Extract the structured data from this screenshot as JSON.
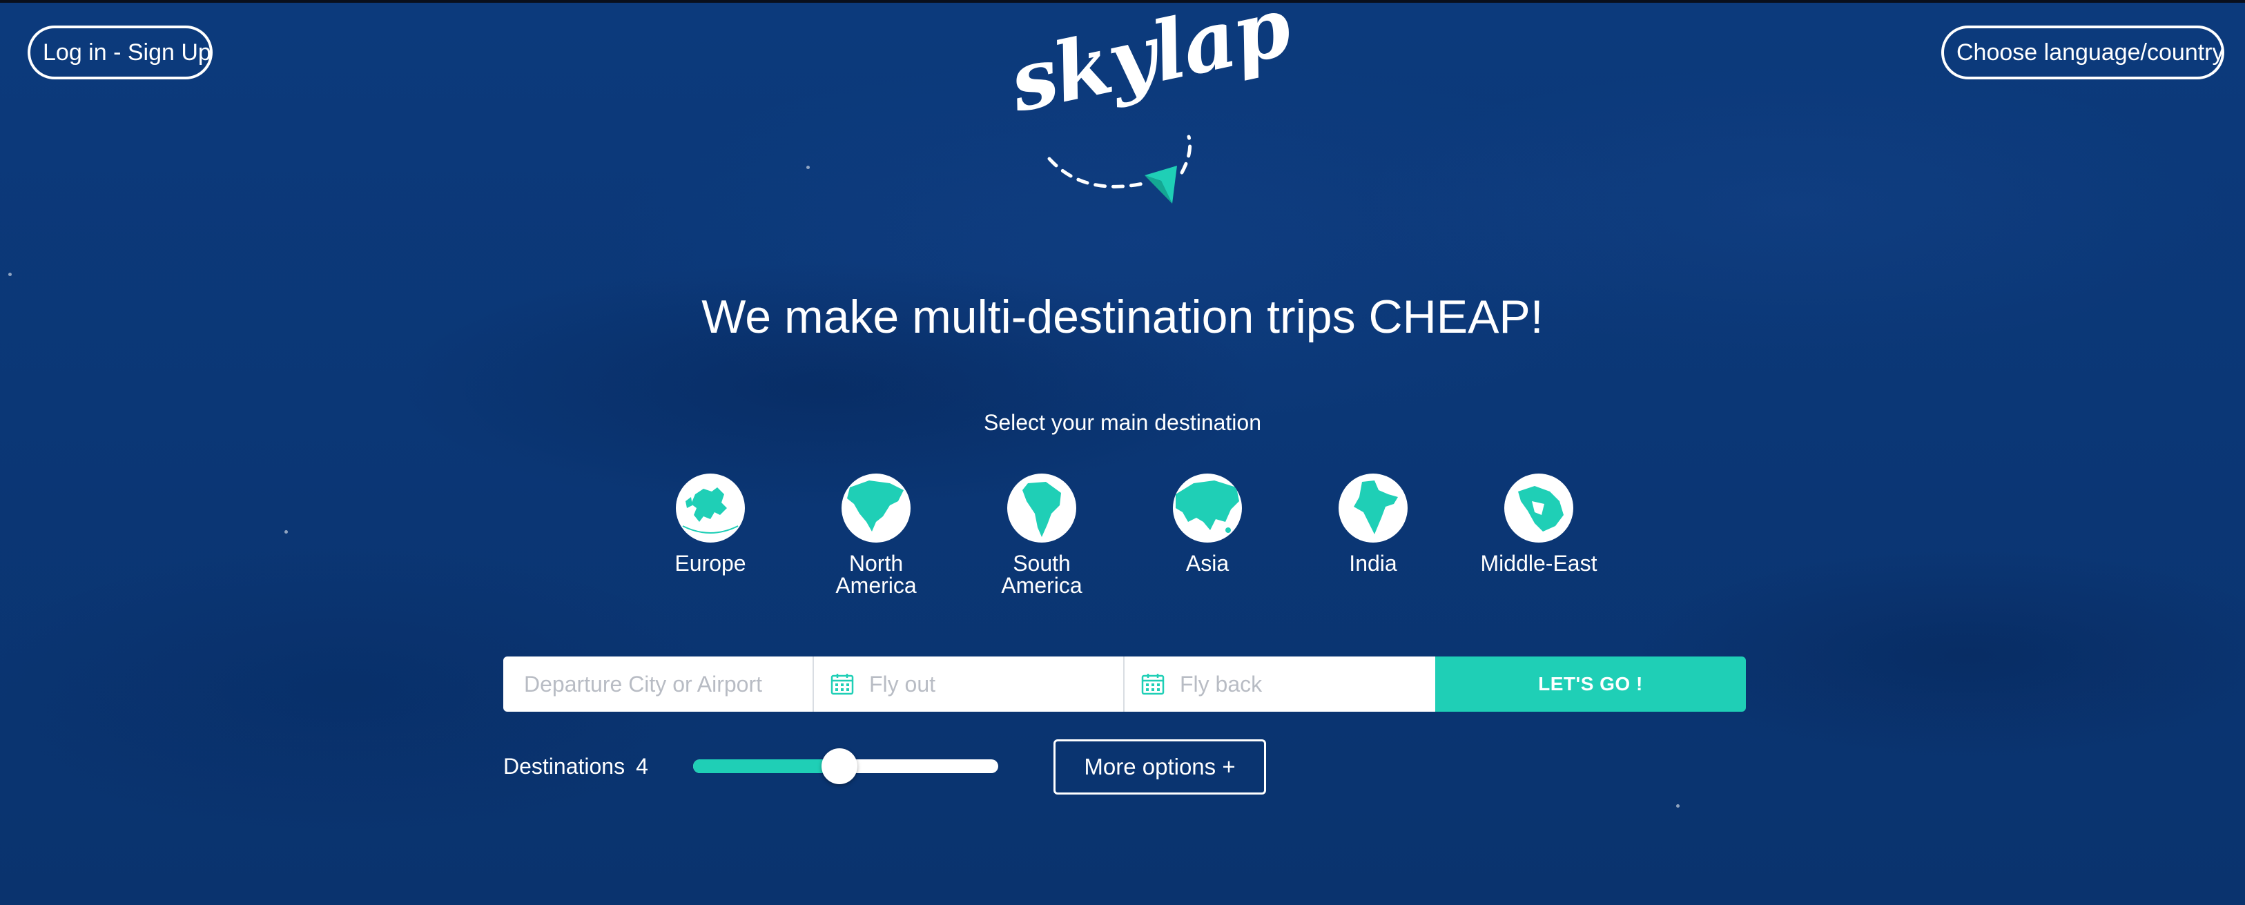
{
  "header": {
    "login_label": "Log in - Sign Up",
    "language_label": "Choose language/country",
    "logo_text": "skylap"
  },
  "hero": {
    "headline": "We make multi-destination trips CHEAP!",
    "subhead": "Select your main destination"
  },
  "destinations": [
    {
      "label": "Europe",
      "icon": "europe-map-icon"
    },
    {
      "label": "North\nAmerica",
      "icon": "north-america-map-icon"
    },
    {
      "label": "South\nAmerica",
      "icon": "south-america-map-icon"
    },
    {
      "label": "Asia",
      "icon": "asia-map-icon"
    },
    {
      "label": "India",
      "icon": "india-map-icon"
    },
    {
      "label": "Middle-East",
      "icon": "middle-east-map-icon"
    }
  ],
  "search": {
    "departure_placeholder": "Departure City or Airport",
    "flyout_placeholder": "Fly out",
    "flyback_placeholder": "Fly back",
    "go_label": "LET'S GO !"
  },
  "options": {
    "destinations_label": "Destinations",
    "destinations_count": "4",
    "slider_fraction": 0.48,
    "more_options_label": "More options +"
  },
  "colors": {
    "accent": "#1fcfb6",
    "background": "#0b3776",
    "text": "#ffffff"
  }
}
